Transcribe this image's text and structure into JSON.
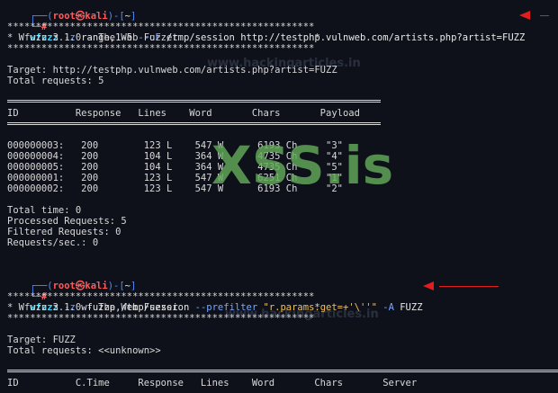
{
  "watermark": {
    "text1": "www.hackingarticles.in",
    "text2": "www.hackingarticles.in",
    "xss": "XSS.is"
  },
  "prompt": {
    "user": "root",
    "host": "kali",
    "path": "~",
    "hash": "#"
  },
  "cmd1": {
    "program": "wfuzz",
    "parts": [
      " -z",
      " range,1-5",
      " --oF",
      " /tmp/session",
      " http://testphp.vulnweb.com/artists.php?artist=FUZZ"
    ]
  },
  "stars": "******************************************************",
  "banner": "* Wfuzz 3.1.0 - The Web Fuzzer                        *",
  "target1": "Target: http://testphp.vulnweb.com/artists.php?artist=FUZZ",
  "total1": "Total requests: 5",
  "header1": "ID          Response   Lines    Word       Chars       Payload",
  "rows": [
    "000000003:   200        123 L    547 W      6193 Ch     \"3\"",
    "000000004:   200        104 L    364 W      4735 Ch     \"4\"",
    "000000005:   200        104 L    364 W      4735 Ch     \"5\"",
    "000000001:   200        123 L    547 W      6251 Ch     \"1\"",
    "000000002:   200        123 L    547 W      6193 Ch     \"2\""
  ],
  "stats": [
    "Total time: 0",
    "Processed Requests: 5",
    "Filtered Requests: 0",
    "Requests/sec.: 0"
  ],
  "cmd2": {
    "program": "wfuzz",
    "parts": [
      " -z",
      " wfuzzp,/tmp/session",
      " --prefilter",
      " \"r.params.get=+'\\''\"",
      " -A",
      " FUZZ"
    ]
  },
  "banner2": "* Wfuzz 3.1.0 - The Web Fuzzer                        *",
  "target2": "Target: FUZZ",
  "total2": "Total requests: <<unknown>>",
  "header2": "ID          C.Time     Response   Lines    Word       Chars       Server"
}
